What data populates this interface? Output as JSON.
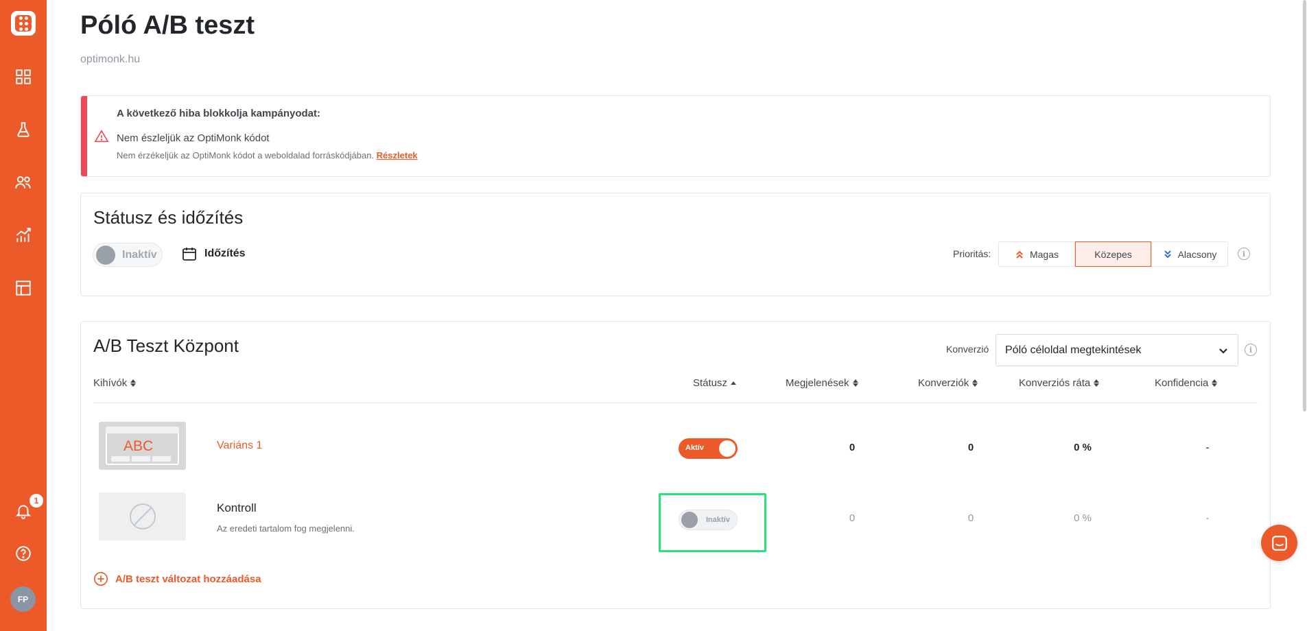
{
  "sidebar": {
    "items": [
      {
        "icon": "dashboard-icon"
      },
      {
        "icon": "experiment-flask-icon"
      },
      {
        "icon": "users-icon"
      },
      {
        "icon": "analytics-chart-icon"
      },
      {
        "icon": "templates-layout-icon"
      }
    ],
    "notification_count": "1",
    "avatar_initials": "FP"
  },
  "header": {
    "title": "Póló A/B teszt",
    "domain": "optimonk.hu"
  },
  "error": {
    "heading": "A következő hiba blokkolja kampányodat:",
    "title": "Nem észleljük az OptiMonk kódot",
    "description": "Nem érzékeljük az OptiMonk kódot a weboldalad forráskódjában.",
    "link": "Részletek"
  },
  "status": {
    "title": "Státusz és időzítés",
    "toggle_label": "Inaktív",
    "schedule_label": "Időzítés",
    "priority_label": "Prioritás:",
    "priority_options": [
      "Magas",
      "Közepes",
      "Alacsony"
    ],
    "priority_selected": "Közepes"
  },
  "ab": {
    "title": "A/B Teszt Központ",
    "conversion_label": "Konverzió",
    "conversion_value": "Póló céloldal megtekintések",
    "columns": [
      "Kihívók",
      "Státusz",
      "Megjelenések",
      "Konverziók",
      "Konverziós ráta",
      "Konfidencia"
    ],
    "rows": [
      {
        "thumb_text": "ABC",
        "name": "Variáns 1",
        "status": "Aktív",
        "impressions": "0",
        "conversions": "0",
        "rate": "0 %",
        "confidence": "-"
      },
      {
        "name": "Kontroll",
        "description": "Az eredeti tartalom fog megjelenni.",
        "status": "Inaktív",
        "impressions": "0",
        "conversions": "0",
        "rate": "0 %",
        "confidence": "-"
      }
    ],
    "add_label": "A/B teszt változat hozzáadása"
  },
  "colors": {
    "brand": "#ed5a29",
    "error": "#e94a57",
    "highlight": "#26e37c"
  }
}
